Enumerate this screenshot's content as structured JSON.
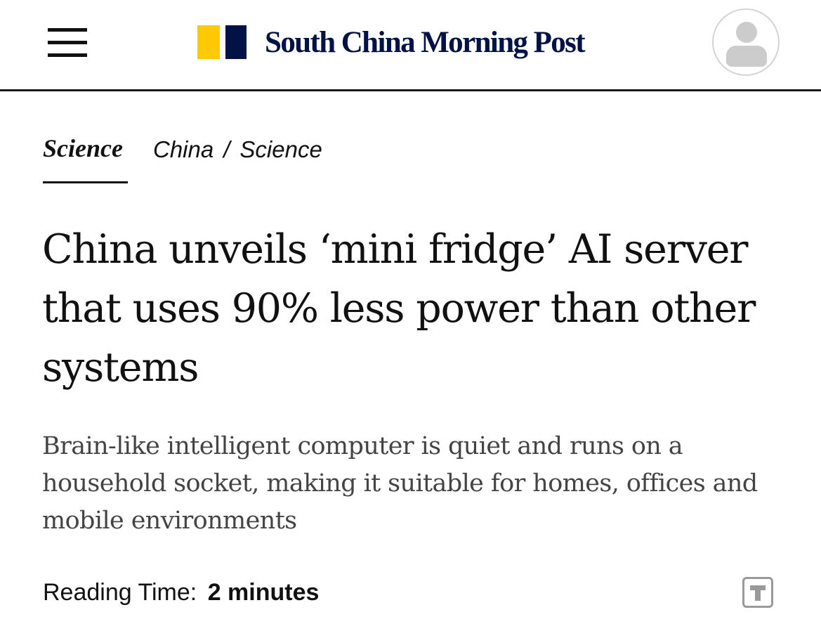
{
  "header": {
    "menu_icon": "hamburger-menu-icon",
    "logo": {
      "text": "South China Morning Post",
      "mark_colors": [
        "#FFCA05",
        "#001246"
      ],
      "text_color": "#001246"
    },
    "account_icon": "user-avatar-icon"
  },
  "section": {
    "active_tab": "Science",
    "breadcrumb": [
      "China",
      "Science"
    ],
    "breadcrumb_separator": "/"
  },
  "article": {
    "headline": "China unveils ‘mini fridge’ AI server that uses 90% less power than other systems",
    "subheadline": "Brain-like intelligent computer is quiet and runs on a household socket, making it suitable for homes, offices and mobile environments",
    "reading_time_label": "Reading Time:",
    "reading_time_value": "2 minutes",
    "text_size_icon": "text-size-icon"
  }
}
